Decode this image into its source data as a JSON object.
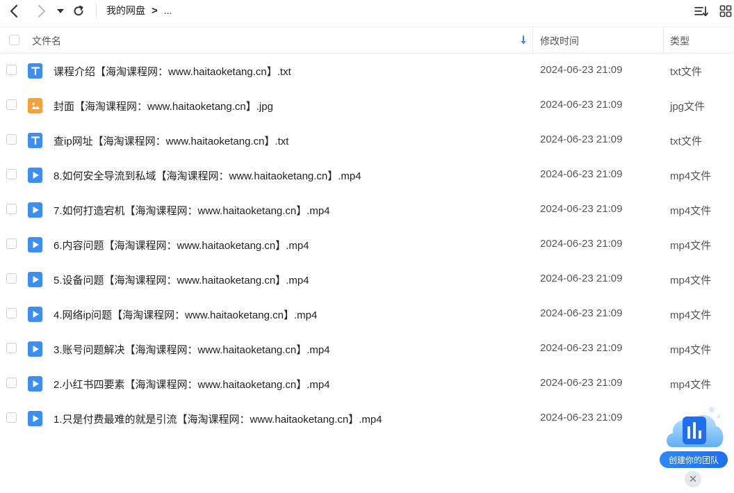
{
  "toolbar": {
    "breadcrumb_root": "我的网盘",
    "breadcrumb_sep": ">",
    "breadcrumb_more": "..."
  },
  "columns": {
    "name": "文件名",
    "modified": "修改时间",
    "type": "类型"
  },
  "files": [
    {
      "name": "课程介绍【海淘课程网：www.haitaoketang.cn】.txt",
      "modified": "2024-06-23 21:09",
      "type": "txt文件",
      "icon": "txt-file-icon"
    },
    {
      "name": "封面【海淘课程网：www.haitaoketang.cn】.jpg",
      "modified": "2024-06-23 21:09",
      "type": "jpg文件",
      "icon": "image-file-icon"
    },
    {
      "name": "查ip网址【海淘课程网：www.haitaoketang.cn】.txt",
      "modified": "2024-06-23 21:09",
      "type": "txt文件",
      "icon": "txt-file-icon"
    },
    {
      "name": "8.如何安全导流到私域【海淘课程网：www.haitaoketang.cn】.mp4",
      "modified": "2024-06-23 21:09",
      "type": "mp4文件",
      "icon": "video-file-icon"
    },
    {
      "name": "7.如何打造宕机【海淘课程网：www.haitaoketang.cn】.mp4",
      "modified": "2024-06-23 21:09",
      "type": "mp4文件",
      "icon": "video-file-icon"
    },
    {
      "name": "6.内容问题【海淘课程网：www.haitaoketang.cn】.mp4",
      "modified": "2024-06-23 21:09",
      "type": "mp4文件",
      "icon": "video-file-icon"
    },
    {
      "name": "5.设备问题【海淘课程网：www.haitaoketang.cn】.mp4",
      "modified": "2024-06-23 21:09",
      "type": "mp4文件",
      "icon": "video-file-icon"
    },
    {
      "name": "4.网络ip问题【海淘课程网：www.haitaoketang.cn】.mp4",
      "modified": "2024-06-23 21:09",
      "type": "mp4文件",
      "icon": "video-file-icon"
    },
    {
      "name": "3.账号问题解决【海淘课程网：www.haitaoketang.cn】.mp4",
      "modified": "2024-06-23 21:09",
      "type": "mp4文件",
      "icon": "video-file-icon"
    },
    {
      "name": "2.小红书四要素【海淘课程网：www.haitaoketang.cn】.mp4",
      "modified": "2024-06-23 21:09",
      "type": "mp4文件",
      "icon": "video-file-icon"
    },
    {
      "name": "1.只是付费最难的就是引流【海淘课程网：www.haitaoketang.cn】.mp4",
      "modified": "2024-06-23 21:09",
      "type": "",
      "icon": "video-file-icon"
    }
  ],
  "promo": {
    "label": "创建你的团队"
  },
  "colors": {
    "accent": "#2b88f5",
    "file_blue": "#3c8ff0",
    "image_orange": "#f7a13b"
  }
}
